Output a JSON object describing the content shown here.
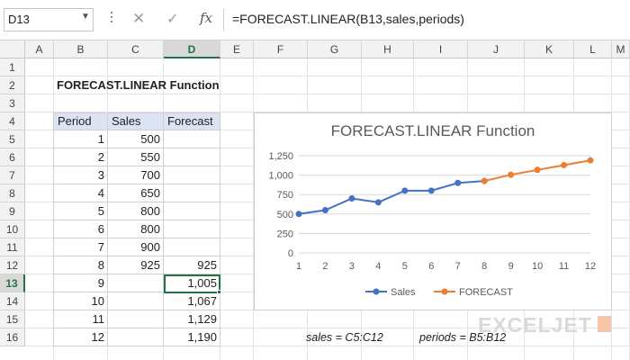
{
  "name_box": {
    "value": "D13"
  },
  "formula_bar": {
    "cancel_glyph": "✕",
    "enter_glyph": "✓",
    "fx_label": "fx",
    "formula": "=FORECAST.LINEAR(B13,sales,periods)"
  },
  "columns": [
    "A",
    "B",
    "C",
    "D",
    "E",
    "F",
    "G",
    "H",
    "I",
    "J",
    "K",
    "L",
    "M"
  ],
  "rows": [
    "1",
    "2",
    "3",
    "4",
    "5",
    "6",
    "7",
    "8",
    "9",
    "10",
    "11",
    "12",
    "13",
    "14",
    "15",
    "16"
  ],
  "sheet": {
    "title": "FORECAST.LINEAR Function",
    "table_headers": [
      "Period",
      "Sales",
      "Forecast"
    ],
    "table_rows": [
      {
        "period": "1",
        "sales": "500",
        "forecast": ""
      },
      {
        "period": "2",
        "sales": "550",
        "forecast": ""
      },
      {
        "period": "3",
        "sales": "700",
        "forecast": ""
      },
      {
        "period": "4",
        "sales": "650",
        "forecast": ""
      },
      {
        "period": "5",
        "sales": "800",
        "forecast": ""
      },
      {
        "period": "6",
        "sales": "800",
        "forecast": ""
      },
      {
        "period": "7",
        "sales": "900",
        "forecast": ""
      },
      {
        "period": "8",
        "sales": "925",
        "forecast": "925"
      },
      {
        "period": "9",
        "sales": "",
        "forecast": "1,005"
      },
      {
        "period": "10",
        "sales": "",
        "forecast": "1,067"
      },
      {
        "period": "11",
        "sales": "",
        "forecast": "1,129"
      },
      {
        "period": "12",
        "sales": "",
        "forecast": "1,190"
      }
    ],
    "active_cell": "D13",
    "note_sales": "sales = C5:C12",
    "note_periods": "periods = B5:B12"
  },
  "chart_data": {
    "type": "line",
    "title": "FORECAST.LINEAR Function",
    "xlabel": "",
    "ylabel": "",
    "x": [
      1,
      2,
      3,
      4,
      5,
      6,
      7,
      8,
      9,
      10,
      11,
      12
    ],
    "x_tick_labels": [
      "1",
      "2",
      "3",
      "4",
      "5",
      "6",
      "7",
      "8",
      "9",
      "10",
      "11",
      "12"
    ],
    "y_tick_labels": [
      "0",
      "250",
      "500",
      "750",
      "1,000",
      "1,250"
    ],
    "ylim": [
      0,
      1250
    ],
    "grid": true,
    "legend_position": "bottom",
    "series": [
      {
        "name": "Sales",
        "color": "#4472c4",
        "x": [
          1,
          2,
          3,
          4,
          5,
          6,
          7,
          8
        ],
        "values": [
          500,
          550,
          700,
          650,
          800,
          800,
          900,
          925
        ]
      },
      {
        "name": "FORECAST",
        "color": "#ed7d31",
        "x": [
          8,
          9,
          10,
          11,
          12
        ],
        "values": [
          925,
          1005,
          1067,
          1129,
          1190
        ]
      }
    ]
  },
  "branding": {
    "logo_text": "EXCELJET"
  },
  "colors": {
    "accent": "#217346",
    "table_header": "#dce3f3"
  }
}
